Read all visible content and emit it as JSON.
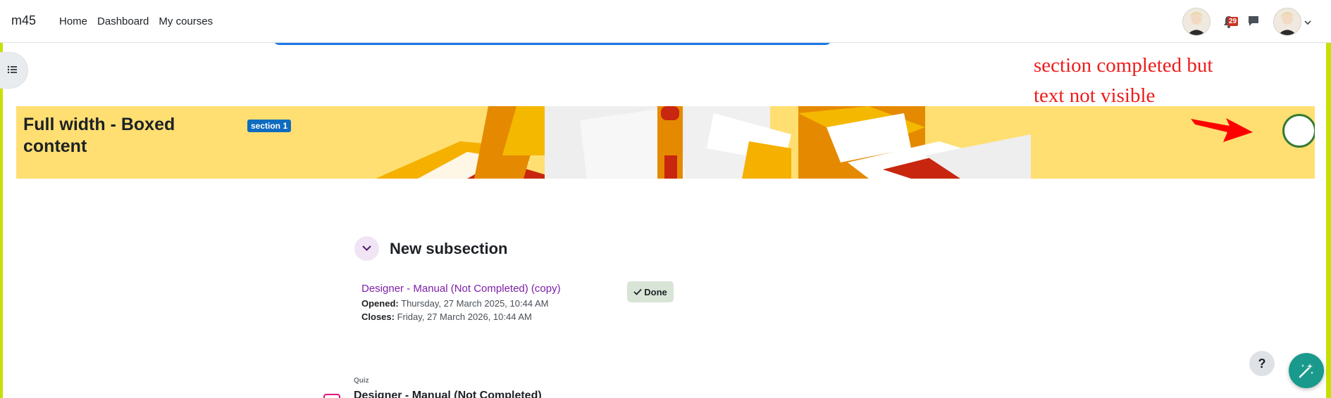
{
  "navbar": {
    "brand": "m45",
    "links": [
      "Home",
      "Dashboard",
      "My courses"
    ],
    "notification_count": "29",
    "icons": [
      "avatar",
      "bell-icon",
      "chat-icon",
      "avatar",
      "chevron-down-icon"
    ]
  },
  "course_index": {
    "icon": "list-icon"
  },
  "section": {
    "title": "Full width - Boxed content",
    "tag": "section 1",
    "banner_color": "#ffdf72",
    "completion_ring_color": "#357a32"
  },
  "annotation": {
    "line1": "section completed but",
    "line2": "text not visible",
    "color": "#ee1c1c"
  },
  "subsection": {
    "title": "New subsection",
    "activity": {
      "name": "Designer - Manual (Not Completed) (copy)",
      "status": "Done",
      "opened_label": "Opened:",
      "opened_value": "Thursday, 27 March 2025, 10:44 AM",
      "closes_label": "Closes:",
      "closes_value": "Friday, 27 March 2026, 10:44 AM"
    }
  },
  "next_activity": {
    "type": "Quiz",
    "name": "Designer - Manual (Not Completed)"
  },
  "floating": {
    "help": "?",
    "assistant_icon": "magic-wand-icon"
  },
  "colors": {
    "accent": "#c6e000",
    "link": "#7d1fa8",
    "primary": "#0f6cbf"
  }
}
